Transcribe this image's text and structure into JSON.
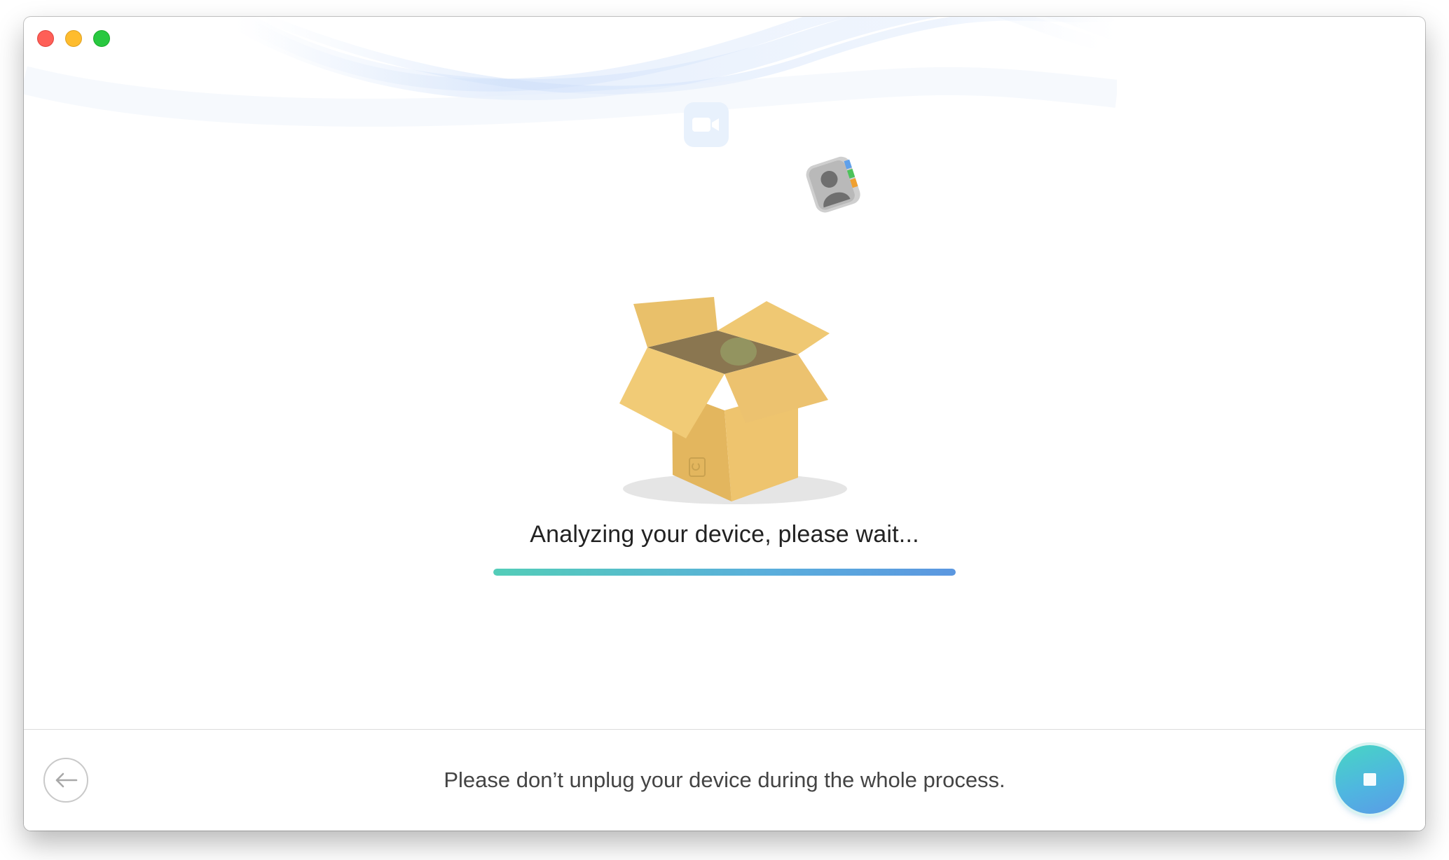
{
  "window": {
    "controls": [
      "close",
      "minimize",
      "zoom"
    ]
  },
  "analysis": {
    "status_text": "Analyzing your device, please wait...",
    "progress_fraction": 1.0
  },
  "footer": {
    "notice": "Please don’t unplug your device during the whole process."
  },
  "icons": {
    "back": "arrow-left-icon",
    "stop": "stop-icon",
    "facetime": "facetime-icon",
    "contacts": "contacts-icon",
    "box": "open-box-icon"
  },
  "colors": {
    "progress_start": "#53cdb8",
    "progress_end": "#5b97e0",
    "stop_button": "#4fb6e0",
    "box": "#eec46e"
  }
}
